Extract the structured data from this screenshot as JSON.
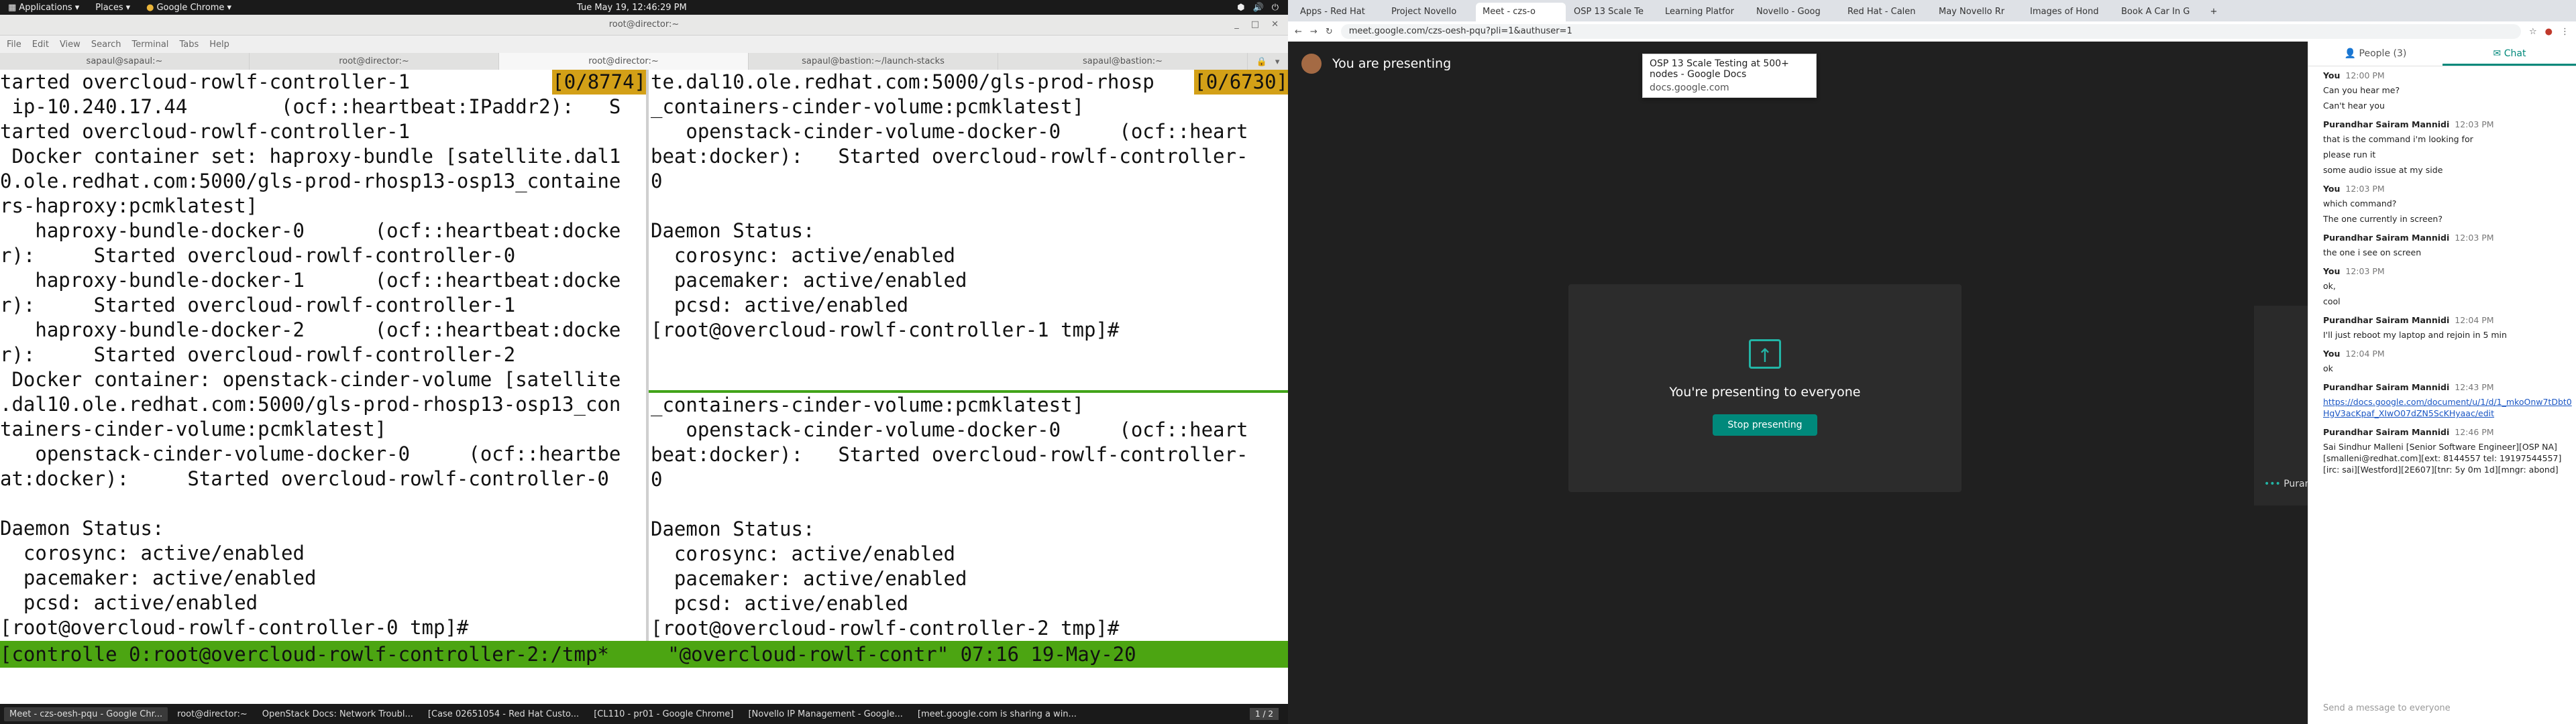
{
  "topbar": {
    "applications": "Applications",
    "places": "Places",
    "active_app": "Google Chrome",
    "clock": "Tue May 19, 12:46:29 PM"
  },
  "terminal": {
    "title": "root@director:~",
    "menu": [
      "File",
      "Edit",
      "View",
      "Search",
      "Terminal",
      "Tabs",
      "Help"
    ],
    "tabs": [
      "sapaul@sapaul:~",
      "root@director:~",
      "root@director:~",
      "sapaul@bastion:~/launch-stacks",
      "sapaul@bastion:~"
    ],
    "left_pane": [
      "tarted overcloud-rowlf-controller-1",
      " ip-10.240.17.44        (ocf::heartbeat:IPaddr2):   S",
      "tarted overcloud-rowlf-controller-1",
      " Docker container set: haproxy-bundle [satellite.dal1",
      "0.ole.redhat.com:5000/gls-prod-rhosp13-osp13_containe",
      "rs-haproxy:pcmklatest]",
      "   haproxy-bundle-docker-0      (ocf::heartbeat:docke",
      "r):     Started overcloud-rowlf-controller-0",
      "   haproxy-bundle-docker-1      (ocf::heartbeat:docke",
      "r):     Started overcloud-rowlf-controller-1",
      "   haproxy-bundle-docker-2      (ocf::heartbeat:docke",
      "r):     Started overcloud-rowlf-controller-2",
      " Docker container: openstack-cinder-volume [satellite",
      ".dal10.ole.redhat.com:5000/gls-prod-rhosp13-osp13_con",
      "tainers-cinder-volume:pcmklatest]",
      "   openstack-cinder-volume-docker-0     (ocf::heartbe",
      "at:docker):     Started overcloud-rowlf-controller-0",
      "",
      "Daemon Status:",
      "  corosync: active/enabled",
      "  pacemaker: active/enabled",
      "  pcsd: active/enabled",
      "[root@overcloud-rowlf-controller-0 tmp]#"
    ],
    "left_badge": "[0/8774]",
    "right_top_badge": "[0/6730]",
    "right_top": [
      "te.dal10.ole.redhat.com:5000/gls-prod-rhosp",
      "_containers-cinder-volume:pcmklatest]",
      "   openstack-cinder-volume-docker-0     (ocf::heart",
      "beat:docker):   Started overcloud-rowlf-controller-",
      "0",
      "",
      "Daemon Status:",
      "  corosync: active/enabled",
      "  pacemaker: active/enabled",
      "  pcsd: active/enabled",
      "[root@overcloud-rowlf-controller-1 tmp]#"
    ],
    "right_bottom": [
      "_containers-cinder-volume:pcmklatest]",
      "   openstack-cinder-volume-docker-0     (ocf::heart",
      "beat:docker):   Started overcloud-rowlf-controller-",
      "0",
      "",
      "Daemon Status:",
      "  corosync: active/enabled",
      "  pacemaker: active/enabled",
      "  pcsd: active/enabled",
      "[root@overcloud-rowlf-controller-2 tmp]#",
      "[root@overcloud-rowlf-controller-2 tmp]# "
    ],
    "status": "[controlle 0:root@overcloud-rowlf-controller-2:/tmp*     \"@overcloud-rowlf-contr\" 07:16 19-May-20"
  },
  "taskbar": {
    "items": [
      "Meet - czs-oesh-pqu - Google Chr...",
      "root@director:~",
      "OpenStack Docs: Network Troubl...",
      "[Case 02651054 - Red Hat Custo...",
      "[CL110 - pr01 - Google Chrome]",
      "[Novello IP Management - Google...",
      "[meet.google.com is sharing a win..."
    ],
    "pager": "1 / 2"
  },
  "chrome": {
    "tabs": [
      "Apps - Red Hat",
      "Project Novello",
      "Meet - czs-o",
      "OSP 13 Scale Te",
      "Learning Platfor",
      "Novello - Goog",
      "Red Hat - Calen",
      "May Novello Rr",
      "Images of Hond",
      "Book A Car In G"
    ],
    "url": "meet.google.com/czs-oesh-pqu?pli=1&authuser=1",
    "tooltip_title": "OSP 13 Scale Testing at 500+ nodes - Google Docs",
    "tooltip_domain": "docs.google.com"
  },
  "meet": {
    "presenting_label": "You are presenting",
    "present_msg": "You're presenting to everyone",
    "stop_label": "Stop presenting",
    "tile_name": "Purandhar Sairam M"
  },
  "chat": {
    "people_tab": "People (3)",
    "chat_tab": "Chat",
    "messages": [
      {
        "who": "You",
        "time": "12:00 PM",
        "lines": [
          "Can you hear me?",
          "Can't hear you"
        ]
      },
      {
        "who": "Purandhar Sairam Mannidi",
        "time": "12:03 PM",
        "lines": [
          "that is the command i'm looking for",
          "please run it",
          "some audio issue at my side"
        ]
      },
      {
        "who": "You",
        "time": "12:03 PM",
        "lines": [
          "which command?",
          "The one currently in screen?"
        ]
      },
      {
        "who": "Purandhar Sairam Mannidi",
        "time": "12:03 PM",
        "lines": [
          "the one i see on screen"
        ]
      },
      {
        "who": "You",
        "time": "12:03 PM",
        "lines": [
          "ok,",
          "cool"
        ]
      },
      {
        "who": "Purandhar Sairam Mannidi",
        "time": "12:04 PM",
        "lines": [
          "I'll just reboot my laptop and rejoin in 5 min"
        ]
      },
      {
        "who": "You",
        "time": "12:04 PM",
        "lines": [
          "ok"
        ]
      },
      {
        "who": "Purandhar Sairam Mannidi",
        "time": "12:43 PM",
        "link": "https://docs.google.com/document/u/1/d/1_mkoOnw7tDbt0HgV3acKpaf_XIwO07dZN5ScKHyaac/edit"
      },
      {
        "who": "Purandhar Sairam Mannidi",
        "time": "12:46 PM",
        "lines": [
          "Sai Sindhur Malleni [Senior Software Engineer][OSP NA][smalleni@redhat.com][ext: 8144557 tel: 19197544557][irc: sai][Westford][2E607][tnr: 5y 0m 1d][mngr: abond]"
        ]
      }
    ],
    "input_placeholder": "Send a message to everyone"
  }
}
